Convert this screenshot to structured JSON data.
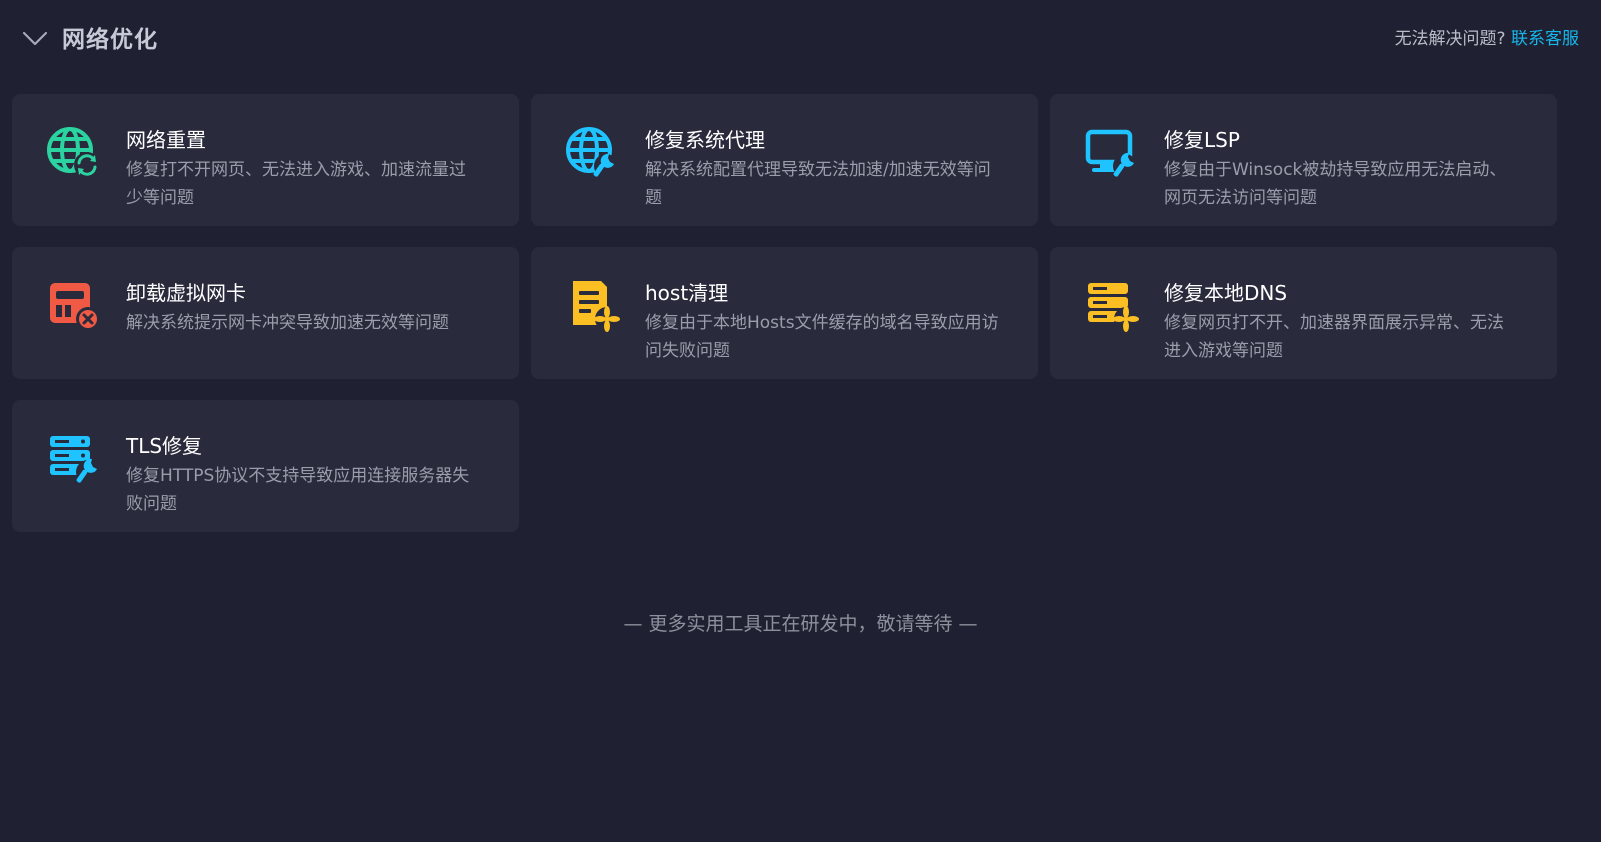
{
  "header": {
    "title": "网络优化",
    "help_text": "无法解决问题?",
    "help_link": "联系客服",
    "toggle_icon": "chevron-down-icon"
  },
  "colors": {
    "background": "#1f2032",
    "card": "#292b3c",
    "link": "#17b6ea",
    "green": "#2ad3a0",
    "cyan": "#1fc3ff",
    "red": "#f05a45",
    "yellow": "#fbbf24"
  },
  "cards": [
    {
      "title": "网络重置",
      "desc": "修复打不开网页、无法进入游戏、加速流量过少等问题",
      "icon": "globe-refresh-icon",
      "color": "#2ad3a0"
    },
    {
      "title": "修复系统代理",
      "desc": "解决系统配置代理导致无法加速/加速无效等问题",
      "icon": "globe-wrench-icon",
      "color": "#1fc3ff"
    },
    {
      "title": "修复LSP",
      "desc": "修复由于Winsock被劫持导致应用无法启动、网页无法访问等问题",
      "icon": "monitor-wrench-icon",
      "color": "#1fc3ff"
    },
    {
      "title": "卸载虚拟网卡",
      "desc": "解决系统提示网卡冲突导致加速无效等问题",
      "icon": "network-card-remove-icon",
      "color": "#f05a45"
    },
    {
      "title": "host清理",
      "desc": "修复由于本地Hosts文件缓存的域名导致应用访问失败问题",
      "icon": "document-fan-icon",
      "color": "#fbbf24"
    },
    {
      "title": "修复本地DNS",
      "desc": "修复网页打不开、加速器界面展示异常、无法进入游戏等问题",
      "icon": "server-fan-icon",
      "color": "#fbbf24"
    },
    {
      "title": "TLS修复",
      "desc": "修复HTTPS协议不支持导致应用连接服务器失败问题",
      "icon": "server-wrench-icon",
      "color": "#1fc3ff"
    }
  ],
  "footer": {
    "note": "— 更多实用工具正在研发中，敬请等待 —"
  }
}
